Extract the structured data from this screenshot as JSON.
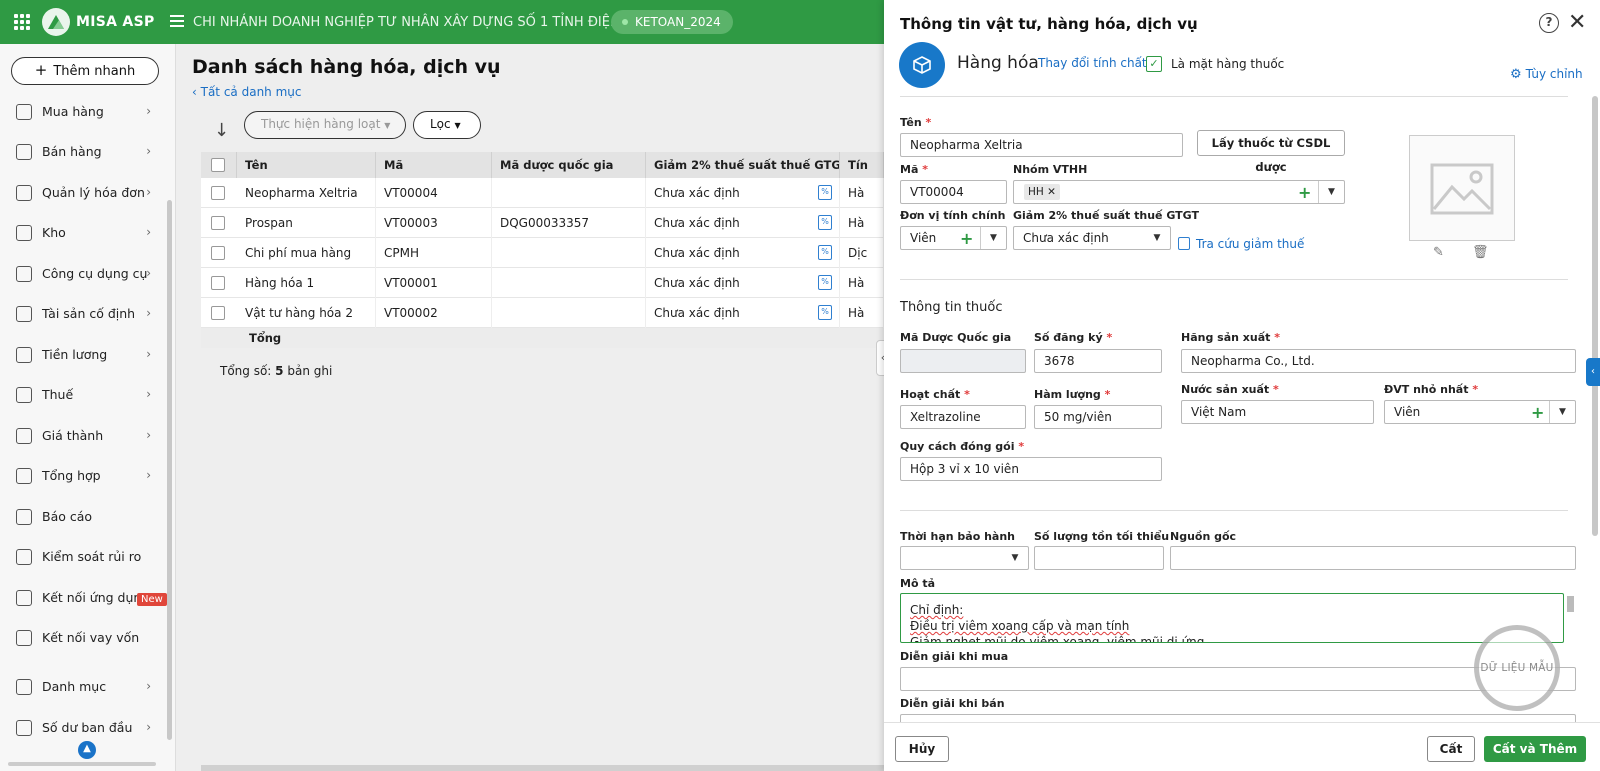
{
  "topbar": {
    "brand": "MISA ASP",
    "company": "CHI NHÁNH DOANH NGHIỆP TƯ NHÂN XÂY DỰNG SỐ 1 TỈNH ĐIỆ...",
    "database": "KETOAN_2024",
    "bar_color": "#2f9a44"
  },
  "sidebar": {
    "quick_add": "Thêm nhanh",
    "new_badge": "New",
    "items": [
      {
        "label": "Mua hàng",
        "icon": "bag-icon"
      },
      {
        "label": "Bán hàng",
        "icon": "cart-icon"
      },
      {
        "label": "Quản lý hóa đơn",
        "icon": "invoice-icon"
      },
      {
        "label": "Kho",
        "icon": "warehouse-icon"
      },
      {
        "label": "Công cụ dụng cụ",
        "icon": "tools-icon"
      },
      {
        "label": "Tài sản cố định",
        "icon": "car-icon"
      },
      {
        "label": "Tiền lương",
        "icon": "payroll-icon"
      },
      {
        "label": "Thuế",
        "icon": "tax-icon"
      },
      {
        "label": "Giá thành",
        "icon": "price-tag-icon"
      },
      {
        "label": "Tổng hợp",
        "icon": "summary-icon"
      },
      {
        "label": "Báo cáo",
        "icon": "report-icon"
      },
      {
        "label": "Kiểm soát rủi ro",
        "icon": "risk-icon"
      },
      {
        "label": "Kết nối ứng dụng",
        "icon": "app-connect-icon"
      },
      {
        "label": "Kết nối vay vốn",
        "icon": "loan-icon"
      },
      {
        "label": "Danh mục",
        "icon": "category-icon"
      },
      {
        "label": "Số dư ban đầu",
        "icon": "balance-icon"
      }
    ]
  },
  "main": {
    "title": "Danh sách hàng hóa, dịch vụ",
    "back_link": "Tất cả danh mục",
    "bulk_action": "Thực hiện hàng loạt",
    "filter": "Lọc",
    "columns": [
      "Tên",
      "Mã",
      "Mã dược quốc gia",
      "Giảm 2% thuế suất thuế GTGT",
      "Tín"
    ],
    "rows": [
      {
        "name": "Neopharma Xeltria",
        "code": "VT00004",
        "national": "",
        "tax": "Chưa xác định",
        "nature": "Hà"
      },
      {
        "name": "Prospan",
        "code": "VT00003",
        "national": "DQG00033357",
        "tax": "Chưa xác định",
        "nature": "Hà"
      },
      {
        "name": "Chi phí mua hàng",
        "code": "CPMH",
        "national": "",
        "tax": "Chưa xác định",
        "nature": "Dịc"
      },
      {
        "name": "Hàng hóa 1",
        "code": "VT00001",
        "national": "",
        "tax": "Chưa xác định",
        "nature": "Hà"
      },
      {
        "name": "Vật tư hàng hóa 2",
        "code": "VT00002",
        "national": "",
        "tax": "Chưa xác định",
        "nature": "Hà"
      }
    ],
    "total_label": "Tổng",
    "record_prefix": "Tổng số: ",
    "record_count": "5",
    "record_suffix": " bản ghi"
  },
  "panel": {
    "title": "Thông tin vật tư, hàng hóa, dịch vụ",
    "type_label": "Hàng hóa",
    "change_link": "Thay đổi tính chất",
    "is_drug_label": "Là mặt hàng thuốc",
    "is_drug_checked": true,
    "customize": "Tùy chỉnh",
    "fields": {
      "name_label": "Tên",
      "name_value": "Neopharma Xeltria",
      "lookup_button": "Lấy thuốc từ CSDL dược",
      "code_label": "Mã",
      "code_value": "VT00004",
      "group_label": "Nhóm VTHH",
      "group_tag": "HH",
      "unit_label": "Đơn vị tính chính",
      "unit_value": "Viên",
      "tax_label": "Giảm 2% thuế suất thuế GTGT",
      "tax_value": "Chưa xác định",
      "tax_lookup": "Tra cứu giảm thuế"
    },
    "drug": {
      "section": "Thông tin thuốc",
      "national_code_label": "Mã Dược Quốc gia",
      "national_code_value": "",
      "reg_no_label": "Số đăng ký",
      "reg_no_value": "3678",
      "manufacturer_label": "Hãng sản xuất",
      "manufacturer_value": "Neopharma Co., Ltd.",
      "ingredient_label": "Hoạt chất",
      "ingredient_value": "Xeltrazoline",
      "content_label": "Hàm lượng",
      "content_value": "50 mg/viên",
      "country_label": "Nước sản xuất",
      "country_value": "Việt Nam",
      "min_unit_label": "ĐVT nhỏ nhất",
      "min_unit_value": "Viên",
      "packing_label": "Quy cách đóng gói",
      "packing_value": "Hộp 3 vỉ x 10 viên"
    },
    "other": {
      "warranty_label": "Thời hạn bảo hành",
      "min_stock_label": "Số lượng tồn tối thiểu",
      "origin_label": "Nguồn gốc",
      "description_label": "Mô tả",
      "description_line1": "Chỉ định:",
      "description_line2": "Điều trị viêm xoang cấp và mạn tính",
      "description_line3": "Giảm nghẹt mũi do viêm xoang, viêm mũi dị ứng",
      "purchase_note_label": "Diễn giải khi mua",
      "sale_note_label": "Diễn giải khi bán"
    },
    "stamp": "DỮ LIỆU MẪU",
    "buttons": {
      "cancel": "Hủy",
      "save": "Cất",
      "save_add": "Cất và Thêm"
    }
  }
}
